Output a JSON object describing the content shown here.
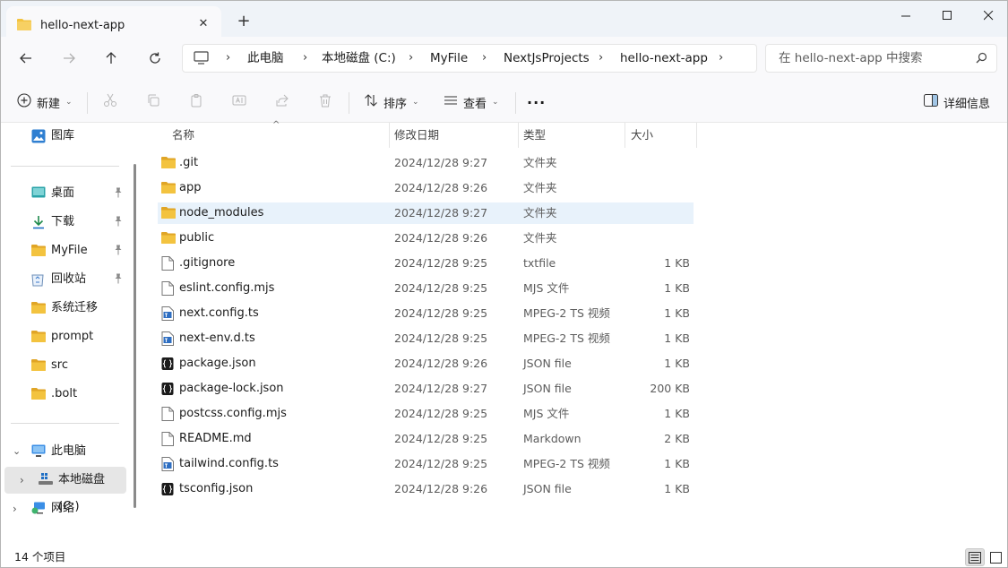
{
  "window": {
    "tab_title": "hello-next-app",
    "new_tab": "+"
  },
  "address": {
    "crumbs": [
      "此电脑",
      "本地磁盘 (C:)",
      "MyFile",
      "NextJsProjects",
      "hello-next-app"
    ],
    "search_placeholder": "在 hello-next-app 中搜索"
  },
  "commands": {
    "new_label": "新建",
    "sort_label": "排序",
    "view_label": "查看",
    "more": "···",
    "details_label": "详细信息"
  },
  "sidebar": {
    "top_item": "图库",
    "quick_access": [
      {
        "label": "桌面",
        "icon": "desktop-icon",
        "pinned": true
      },
      {
        "label": "下载",
        "icon": "download-icon",
        "pinned": true
      },
      {
        "label": "MyFile",
        "icon": "folder-icon",
        "pinned": true
      },
      {
        "label": "回收站",
        "icon": "recycle-bin-icon",
        "pinned": true
      },
      {
        "label": "系统迁移",
        "icon": "folder-icon",
        "pinned": false
      },
      {
        "label": "prompt",
        "icon": "folder-icon",
        "pinned": false
      },
      {
        "label": "src",
        "icon": "folder-icon",
        "pinned": false
      },
      {
        "label": ".bolt",
        "icon": "folder-icon",
        "pinned": false
      }
    ],
    "this_pc": "此电脑",
    "local_disk": "本地磁盘 (C:)",
    "network": "网络"
  },
  "columns": {
    "name": "名称",
    "date": "修改日期",
    "type": "类型",
    "size": "大小"
  },
  "files": [
    {
      "name": ".git",
      "date": "2024/12/28 9:27",
      "type": "文件夹",
      "size": "",
      "icon": "folder"
    },
    {
      "name": "app",
      "date": "2024/12/28 9:26",
      "type": "文件夹",
      "size": "",
      "icon": "folder"
    },
    {
      "name": "node_modules",
      "date": "2024/12/28 9:27",
      "type": "文件夹",
      "size": "",
      "icon": "folder"
    },
    {
      "name": "public",
      "date": "2024/12/28 9:26",
      "type": "文件夹",
      "size": "",
      "icon": "folder"
    },
    {
      "name": ".gitignore",
      "date": "2024/12/28 9:25",
      "type": "txtfile",
      "size": "1 KB",
      "icon": "file"
    },
    {
      "name": "eslint.config.mjs",
      "date": "2024/12/28 9:25",
      "type": "MJS 文件",
      "size": "1 KB",
      "icon": "file"
    },
    {
      "name": "next.config.ts",
      "date": "2024/12/28 9:25",
      "type": "MPEG-2 TS 视频",
      "size": "1 KB",
      "icon": "ts"
    },
    {
      "name": "next-env.d.ts",
      "date": "2024/12/28 9:25",
      "type": "MPEG-2 TS 视频",
      "size": "1 KB",
      "icon": "ts"
    },
    {
      "name": "package.json",
      "date": "2024/12/28 9:26",
      "type": "JSON file",
      "size": "1 KB",
      "icon": "json"
    },
    {
      "name": "package-lock.json",
      "date": "2024/12/28 9:27",
      "type": "JSON file",
      "size": "200 KB",
      "icon": "json"
    },
    {
      "name": "postcss.config.mjs",
      "date": "2024/12/28 9:25",
      "type": "MJS 文件",
      "size": "1 KB",
      "icon": "file"
    },
    {
      "name": "README.md",
      "date": "2024/12/28 9:25",
      "type": "Markdown",
      "size": "2 KB",
      "icon": "file"
    },
    {
      "name": "tailwind.config.ts",
      "date": "2024/12/28 9:25",
      "type": "MPEG-2 TS 视频",
      "size": "1 KB",
      "icon": "ts"
    },
    {
      "name": "tsconfig.json",
      "date": "2024/12/28 9:26",
      "type": "JSON file",
      "size": "1 KB",
      "icon": "json"
    }
  ],
  "hovered_row": 2,
  "status": {
    "item_count": "14 个项目"
  },
  "colors": {
    "folder": "#f3c33f",
    "folder_dark": "#e0a526",
    "accent": "#0067c0",
    "hover_row": "#e8f2fb"
  }
}
